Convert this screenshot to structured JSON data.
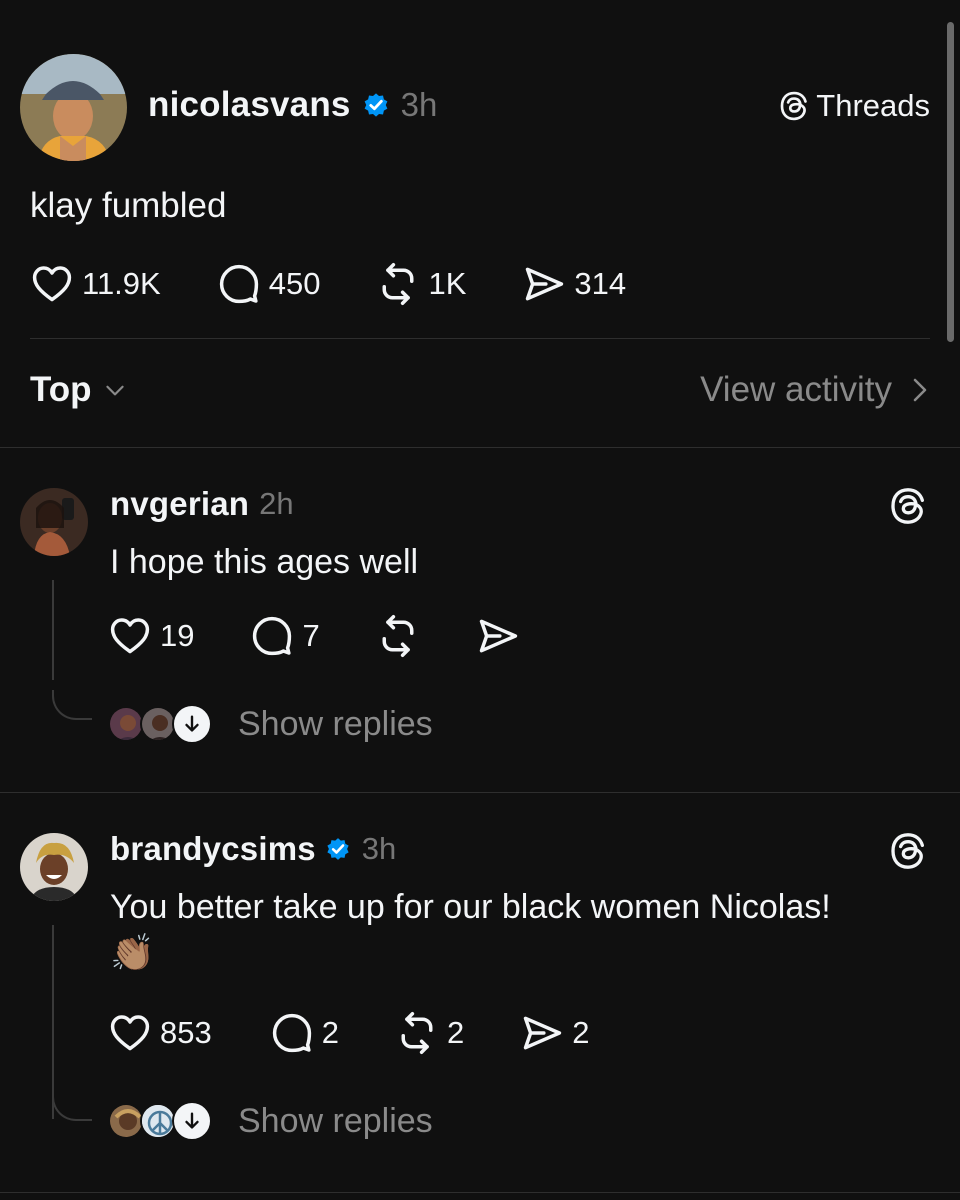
{
  "main_post": {
    "username": "nicolasvans",
    "time": "3h",
    "threads_label": "Threads",
    "text": "klay fumbled",
    "likes": "11.9K",
    "comments": "450",
    "reposts": "1K",
    "shares": "314"
  },
  "sort": {
    "label": "Top",
    "view_activity": "View activity"
  },
  "replies": [
    {
      "username": "nvgerian",
      "time": "2h",
      "text": "I hope this ages well",
      "likes": "19",
      "comments": "7",
      "reposts": "",
      "shares": "",
      "show_replies": "Show replies"
    },
    {
      "username": "brandycsims",
      "time": "3h",
      "text": "You better take up for our black women Nicolas!",
      "emoji": "👏🏽",
      "likes": "853",
      "comments": "2",
      "reposts": "2",
      "shares": "2",
      "show_replies": "Show replies"
    }
  ],
  "colors": {
    "background": "#101010",
    "primary_text": "#f3f5f7",
    "secondary_text": "#777777",
    "verified_blue": "#0095f6"
  },
  "icons": [
    "heart-icon",
    "comment-icon",
    "repost-icon",
    "share-icon",
    "threads-logo-icon",
    "verified-badge-icon",
    "chevron-down-icon",
    "chevron-right-icon",
    "arrow-down-icon"
  ]
}
